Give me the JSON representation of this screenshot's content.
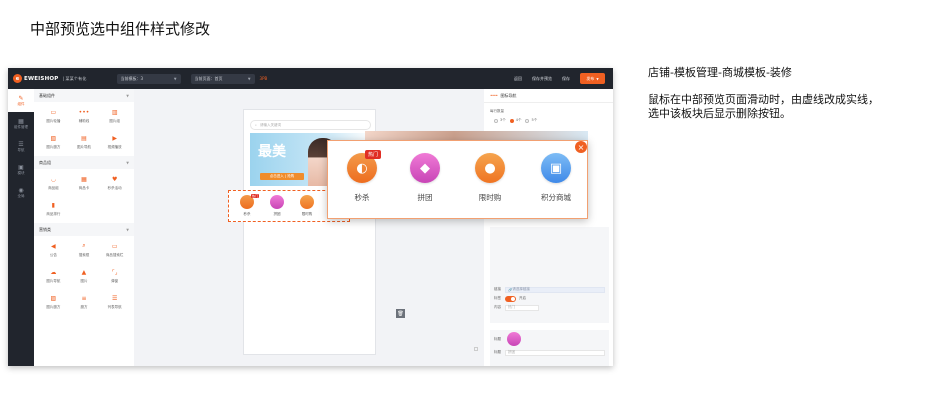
{
  "page_title": "中部预览选中组件样式修改",
  "app": {
    "logo_text": "EWEISHOP",
    "logo_sub": "| 某某个有化",
    "template_select": "当前模板：3",
    "page_select": "当前页面：首页",
    "badge": "3PB",
    "top_links": [
      "返回",
      "保存并预览",
      "保存"
    ],
    "publish_button": "发布"
  },
  "side_nav": [
    "组件",
    "组件管理",
    "导航",
    "模块",
    "全局"
  ],
  "palette": {
    "sections": [
      {
        "title": "基础组件",
        "items": [
          "图片轮播",
          "辅助线",
          "图片组",
          "图片魔方",
          "图片导航",
          "视频播放"
        ]
      },
      {
        "title": "商品组",
        "items": [
          "商品组",
          "商品卡",
          "秒杀活动",
          "商品排行"
        ]
      },
      {
        "title": "营销类",
        "items": [
          "公告",
          "搜索框",
          "商品搜索栏",
          "图片导航",
          "图片",
          "弹窗",
          "图片魔方",
          "魔方",
          "列表导航"
        ]
      }
    ]
  },
  "phone": {
    "search_placeholder": "请输入关键词",
    "banner_big": "最美",
    "banner_tag": "点击进入 | 抢购",
    "nav_items": [
      "秒杀",
      "拼团",
      "限时购"
    ],
    "badge": "热门"
  },
  "popout": {
    "items": [
      "秒杀",
      "拼团",
      "限时购",
      "积分商城"
    ],
    "badge": "热门",
    "close_icon": "×"
  },
  "right_panel": {
    "title": "图标导航",
    "row_count_label": "每行数量",
    "radio_options": [
      "3个",
      "4个",
      "5个"
    ],
    "selected_radio": 1,
    "cards": [
      {
        "name_label": "标题",
        "name_value": "秒杀",
        "link_label": "链接",
        "link_value": "请选择链接",
        "tag_label": "标签",
        "tag_value": "开启",
        "text_label": "内容",
        "text_value": "热门"
      },
      {
        "name_label": "标题",
        "name_value": "拼团",
        "link_label": "链接",
        "link_value": "请选择链接",
        "tag_label": "标签",
        "tag_value": "关闭"
      },
      {
        "name_label": "标题",
        "name_value": "限时购"
      }
    ]
  },
  "annotation": {
    "title": "店铺-模板管理-商城模板-装修",
    "body": "鼠标在中部预览页面滑动时，由虚线改成实线，选中该板块后显示删除按钮。"
  },
  "colors": {
    "accent": "#f06022",
    "topbar": "#21252d"
  }
}
